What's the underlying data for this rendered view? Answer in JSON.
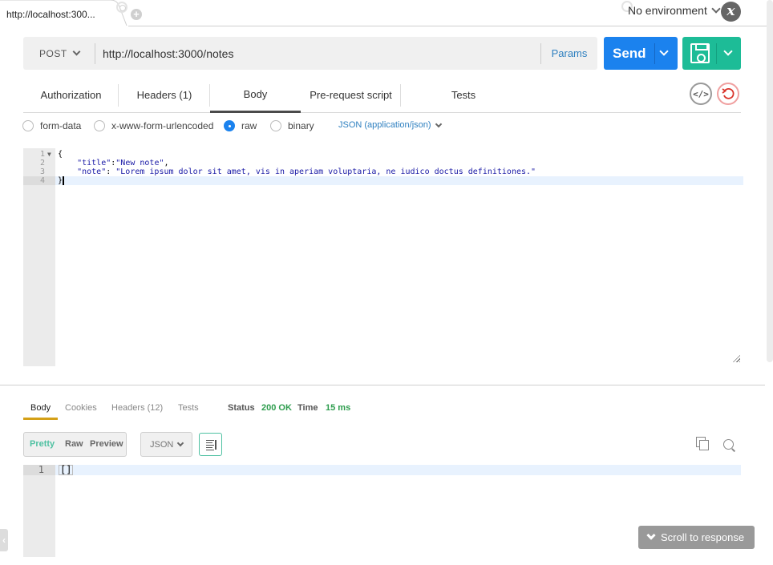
{
  "tabs": {
    "active_label": "http://localhost:300...",
    "add_tab_icon": "plus-circle-icon"
  },
  "environment": {
    "selected": "No environment",
    "logo_glyph": "x"
  },
  "request": {
    "method": "POST",
    "url": "http://localhost:3000/notes",
    "params_label": "Params",
    "send_label": "Send",
    "save_icon": "floppy-disk-icon"
  },
  "request_tabs": [
    {
      "label": "Authorization",
      "active": false
    },
    {
      "label": "Headers (1)",
      "active": false
    },
    {
      "label": "Body",
      "active": true
    },
    {
      "label": "Pre-request script",
      "active": false
    },
    {
      "label": "Tests",
      "active": false
    }
  ],
  "icons": {
    "code": "</>",
    "reset": "reset-icon"
  },
  "body_types": [
    {
      "label": "form-data",
      "checked": false
    },
    {
      "label": "x-www-form-urlencoded",
      "checked": false
    },
    {
      "label": "raw",
      "checked": true
    },
    {
      "label": "binary",
      "checked": false
    }
  ],
  "content_type": "JSON (application/json)",
  "request_body": {
    "lines": [
      {
        "n": "1",
        "open": "{"
      },
      {
        "n": "2",
        "key": "\"title\"",
        "sep": ":",
        "value": "\"New note\"",
        "end": ","
      },
      {
        "n": "3",
        "key": "\"note\"",
        "sep": ": ",
        "value": "\"Lorem ipsum dolor sit amet, vis in aperiam voluptaria, ne iudico doctus definitiones.\"",
        "end": ""
      },
      {
        "n": "4",
        "close": "}"
      }
    ]
  },
  "response": {
    "tabs": [
      {
        "label": "Body",
        "active": true
      },
      {
        "label": "Cookies",
        "active": false
      },
      {
        "label": "Headers (12)",
        "active": false
      },
      {
        "label": "Tests",
        "active": false
      }
    ],
    "status_label": "Status",
    "status_value": "200 OK",
    "time_label": "Time",
    "time_value": "15 ms",
    "view_modes": [
      {
        "label": "Pretty",
        "active": true
      },
      {
        "label": "Raw",
        "active": false
      },
      {
        "label": "Preview",
        "active": false
      }
    ],
    "format": "JSON",
    "body_line_number": "1",
    "body_text": "[]",
    "scroll_to_response_label": "Scroll to response"
  },
  "colors": {
    "send": "#1b82ee",
    "save": "#1dbc97",
    "status_ok": "#2e9d4e",
    "active_response_tab": "#d4a017",
    "pretty_active": "#4fc1a2",
    "link": "#2f80c0"
  }
}
